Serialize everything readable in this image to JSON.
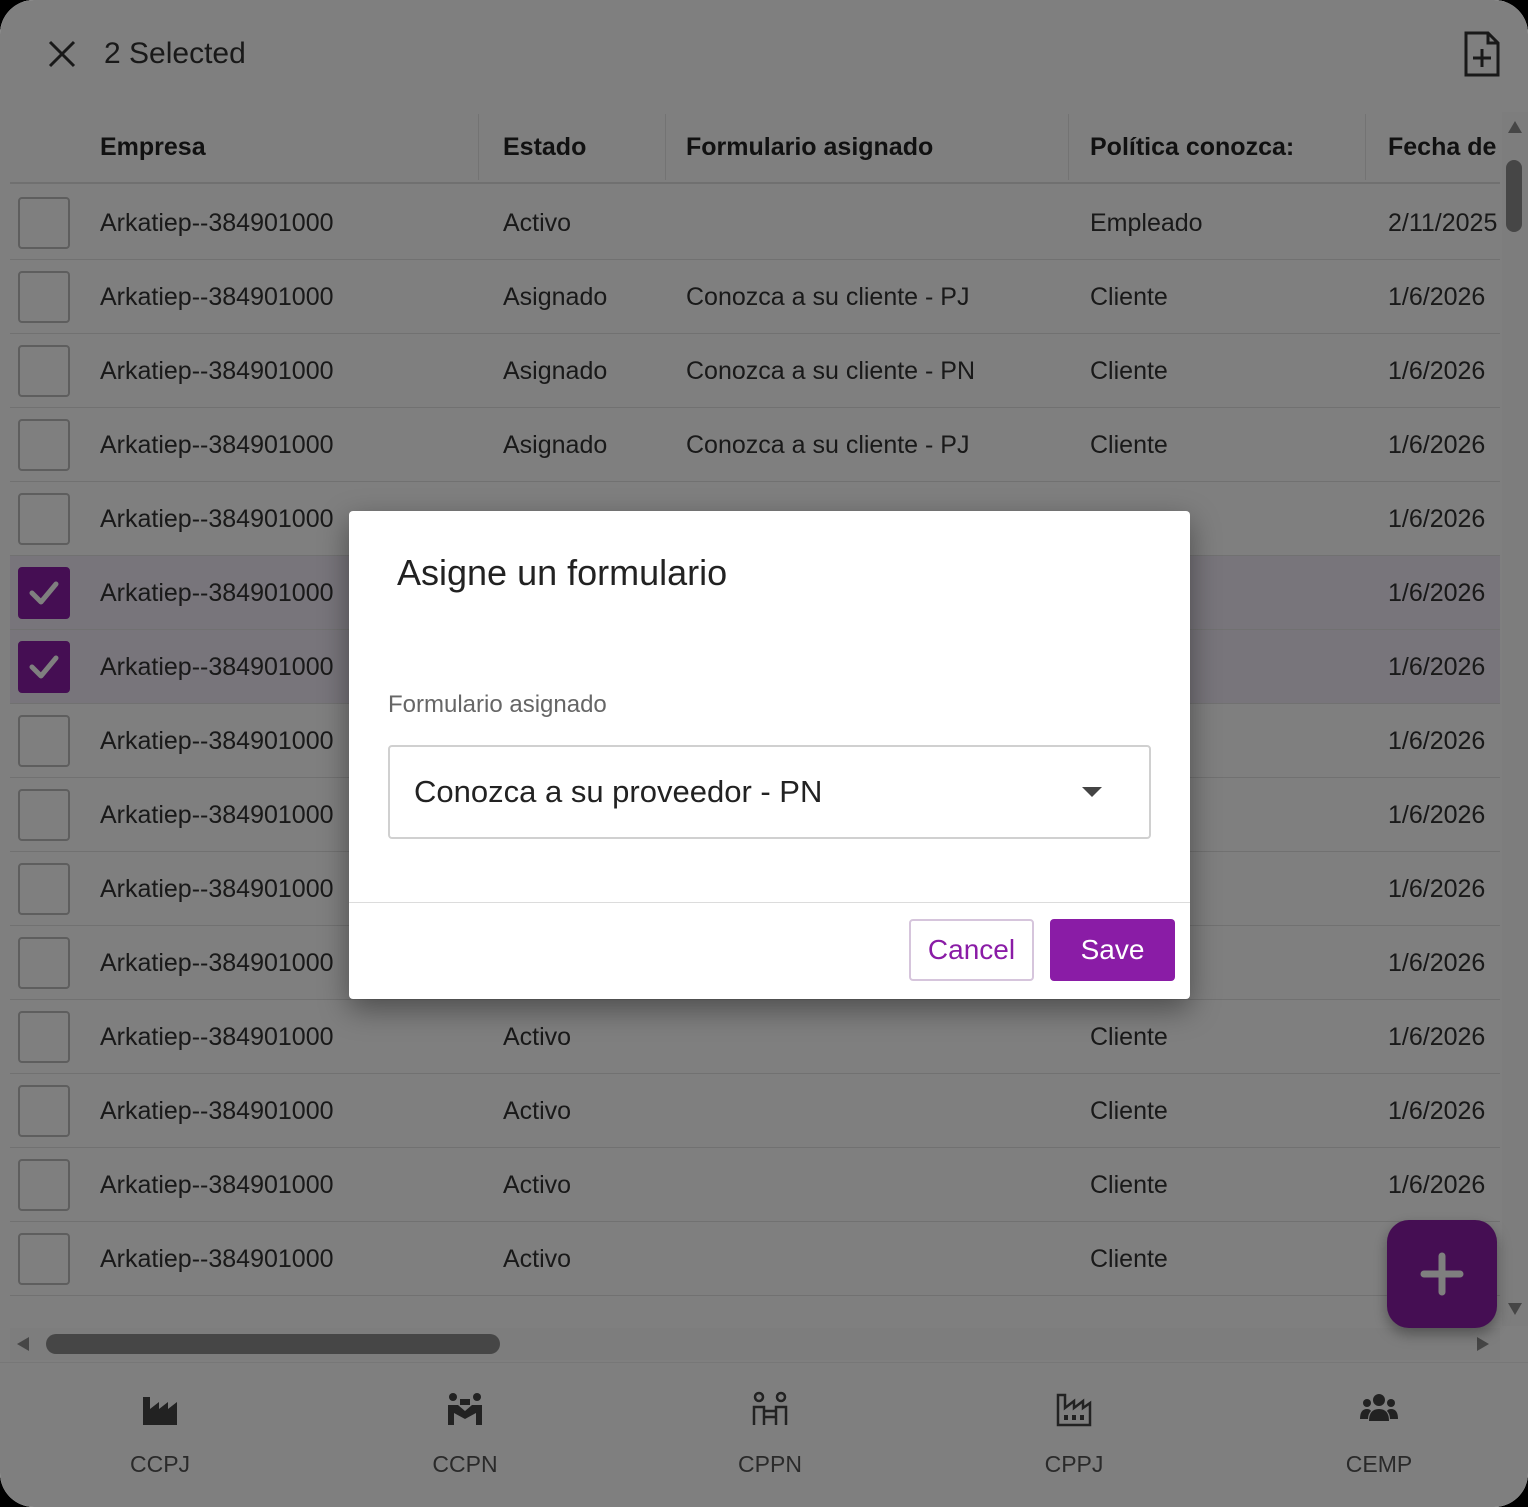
{
  "selection_bar": {
    "count_text": "2 Selected"
  },
  "grid": {
    "columns": [
      "Empresa",
      "Estado",
      "Formulario asignado",
      "Política conozca:",
      "Fecha de"
    ],
    "rows": [
      {
        "empresa": "Arkatiep--384901000",
        "estado": "Activo",
        "formulario": "",
        "politica": "Empleado",
        "fecha": "2/11/2025",
        "checked": false
      },
      {
        "empresa": "Arkatiep--384901000",
        "estado": "Asignado",
        "formulario": "Conozca a su cliente - PJ",
        "politica": "Cliente",
        "fecha": "1/6/2026",
        "checked": false
      },
      {
        "empresa": "Arkatiep--384901000",
        "estado": "Asignado",
        "formulario": "Conozca a su cliente - PN",
        "politica": "Cliente",
        "fecha": "1/6/2026",
        "checked": false
      },
      {
        "empresa": "Arkatiep--384901000",
        "estado": "Asignado",
        "formulario": "Conozca a su cliente - PJ",
        "politica": "Cliente",
        "fecha": "1/6/2026",
        "checked": false
      },
      {
        "empresa": "Arkatiep--384901000",
        "estado": "",
        "formulario": "",
        "politica": "",
        "fecha": "1/6/2026",
        "checked": false
      },
      {
        "empresa": "Arkatiep--384901000",
        "estado": "",
        "formulario": "",
        "politica": "",
        "fecha": "1/6/2026",
        "checked": true
      },
      {
        "empresa": "Arkatiep--384901000",
        "estado": "",
        "formulario": "",
        "politica": "",
        "fecha": "1/6/2026",
        "checked": true
      },
      {
        "empresa": "Arkatiep--384901000",
        "estado": "",
        "formulario": "",
        "politica": "",
        "fecha": "1/6/2026",
        "checked": false
      },
      {
        "empresa": "Arkatiep--384901000",
        "estado": "",
        "formulario": "",
        "politica": "",
        "fecha": "1/6/2026",
        "checked": false
      },
      {
        "empresa": "Arkatiep--384901000",
        "estado": "",
        "formulario": "",
        "politica": "",
        "fecha": "1/6/2026",
        "checked": false
      },
      {
        "empresa": "Arkatiep--384901000",
        "estado": "",
        "formulario": "",
        "politica": "",
        "fecha": "1/6/2026",
        "checked": false
      },
      {
        "empresa": "Arkatiep--384901000",
        "estado": "Activo",
        "formulario": "",
        "politica": "Cliente",
        "fecha": "1/6/2026",
        "checked": false
      },
      {
        "empresa": "Arkatiep--384901000",
        "estado": "Activo",
        "formulario": "",
        "politica": "Cliente",
        "fecha": "1/6/2026",
        "checked": false
      },
      {
        "empresa": "Arkatiep--384901000",
        "estado": "Activo",
        "formulario": "",
        "politica": "Cliente",
        "fecha": "1/6/2026",
        "checked": false
      },
      {
        "empresa": "Arkatiep--384901000",
        "estado": "Activo",
        "formulario": "",
        "politica": "Cliente",
        "fecha": "",
        "checked": false
      }
    ]
  },
  "bottom_nav": [
    {
      "label": "CCPJ",
      "icon": "factory-icon"
    },
    {
      "label": "CCPN",
      "icon": "handshake-people-icon"
    },
    {
      "label": "CPPN",
      "icon": "people-exchange-icon"
    },
    {
      "label": "CPPJ",
      "icon": "factory-outline-icon"
    },
    {
      "label": "CEMP",
      "icon": "group-icon"
    }
  ],
  "dialog": {
    "title": "Asigne un formulario",
    "field_label": "Formulario asignado",
    "selected_value": "Conozca a su proveedor - PN",
    "cancel_label": "Cancel",
    "save_label": "Save"
  },
  "colors": {
    "accent": "#8a1ca6",
    "overlay": "rgba(0,0,0,0.5)"
  }
}
